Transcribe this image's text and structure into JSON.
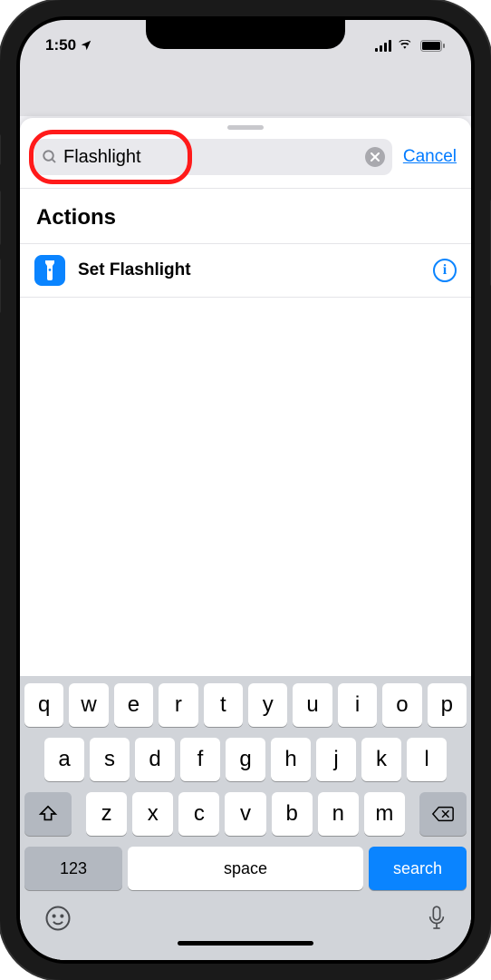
{
  "status": {
    "time": "1:50",
    "location_icon": "location-arrow"
  },
  "sheet": {
    "search": {
      "value": "Flashlight",
      "placeholder": "Search"
    },
    "cancel_label": "Cancel",
    "section_title": "Actions",
    "results": [
      {
        "title": "Set Flashlight",
        "icon": "flashlight-icon",
        "accent": "#0a84ff"
      }
    ]
  },
  "keyboard": {
    "rows": [
      [
        "q",
        "w",
        "e",
        "r",
        "t",
        "y",
        "u",
        "i",
        "o",
        "p"
      ],
      [
        "a",
        "s",
        "d",
        "f",
        "g",
        "h",
        "j",
        "k",
        "l"
      ],
      [
        "z",
        "x",
        "c",
        "v",
        "b",
        "n",
        "m"
      ]
    ],
    "numeric_label": "123",
    "space_label": "space",
    "return_label": "search"
  },
  "annotation": {
    "highlight": "search-field"
  }
}
